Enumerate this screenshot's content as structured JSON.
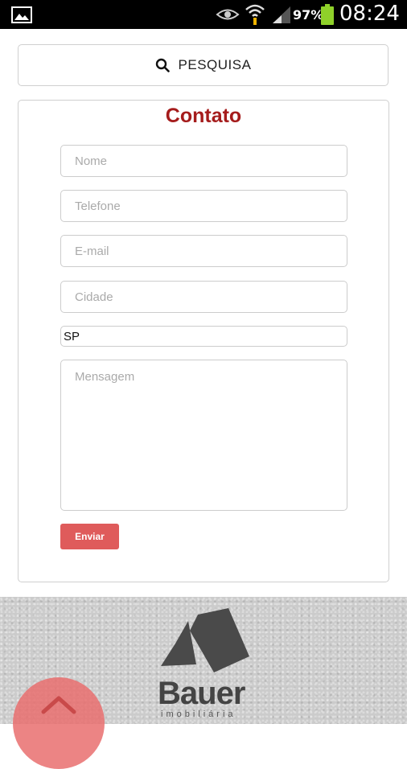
{
  "status_bar": {
    "battery_percent": "97%",
    "time": "08:24",
    "icons": [
      "gallery-icon",
      "eye-icon",
      "wifi-icon",
      "signal-icon",
      "battery-icon"
    ]
  },
  "search": {
    "label": "PESQUISA",
    "icon": "search-icon"
  },
  "contact": {
    "title": "Contato",
    "fields": {
      "name_placeholder": "Nome",
      "phone_placeholder": "Telefone",
      "email_placeholder": "E-mail",
      "city_placeholder": "Cidade",
      "state_value": "SP",
      "message_placeholder": "Mensagem"
    },
    "submit_label": "Enviar"
  },
  "footer": {
    "brand_name": "Bauer",
    "brand_subtitle": "imobiliária"
  },
  "colors": {
    "title_red": "#a51c1c",
    "button_red": "#df5b5b",
    "scroll_button": "#e96e6e"
  }
}
